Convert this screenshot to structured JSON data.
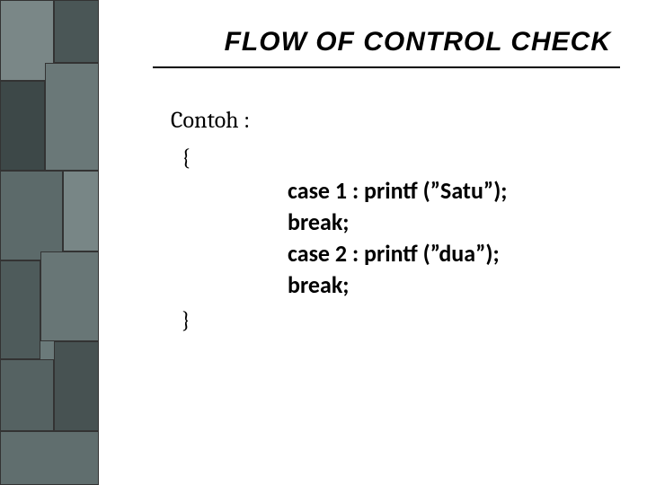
{
  "slide": {
    "title": "FLOW OF CONTROL CHECK",
    "subtitle": "Contoh :",
    "brace_open": "{",
    "brace_close": "}",
    "code": {
      "line1": "case 1 : printf (”Satu”);",
      "line2": "break;",
      "line3": "case 2 : printf (”dua”);",
      "line4": "break;"
    }
  }
}
